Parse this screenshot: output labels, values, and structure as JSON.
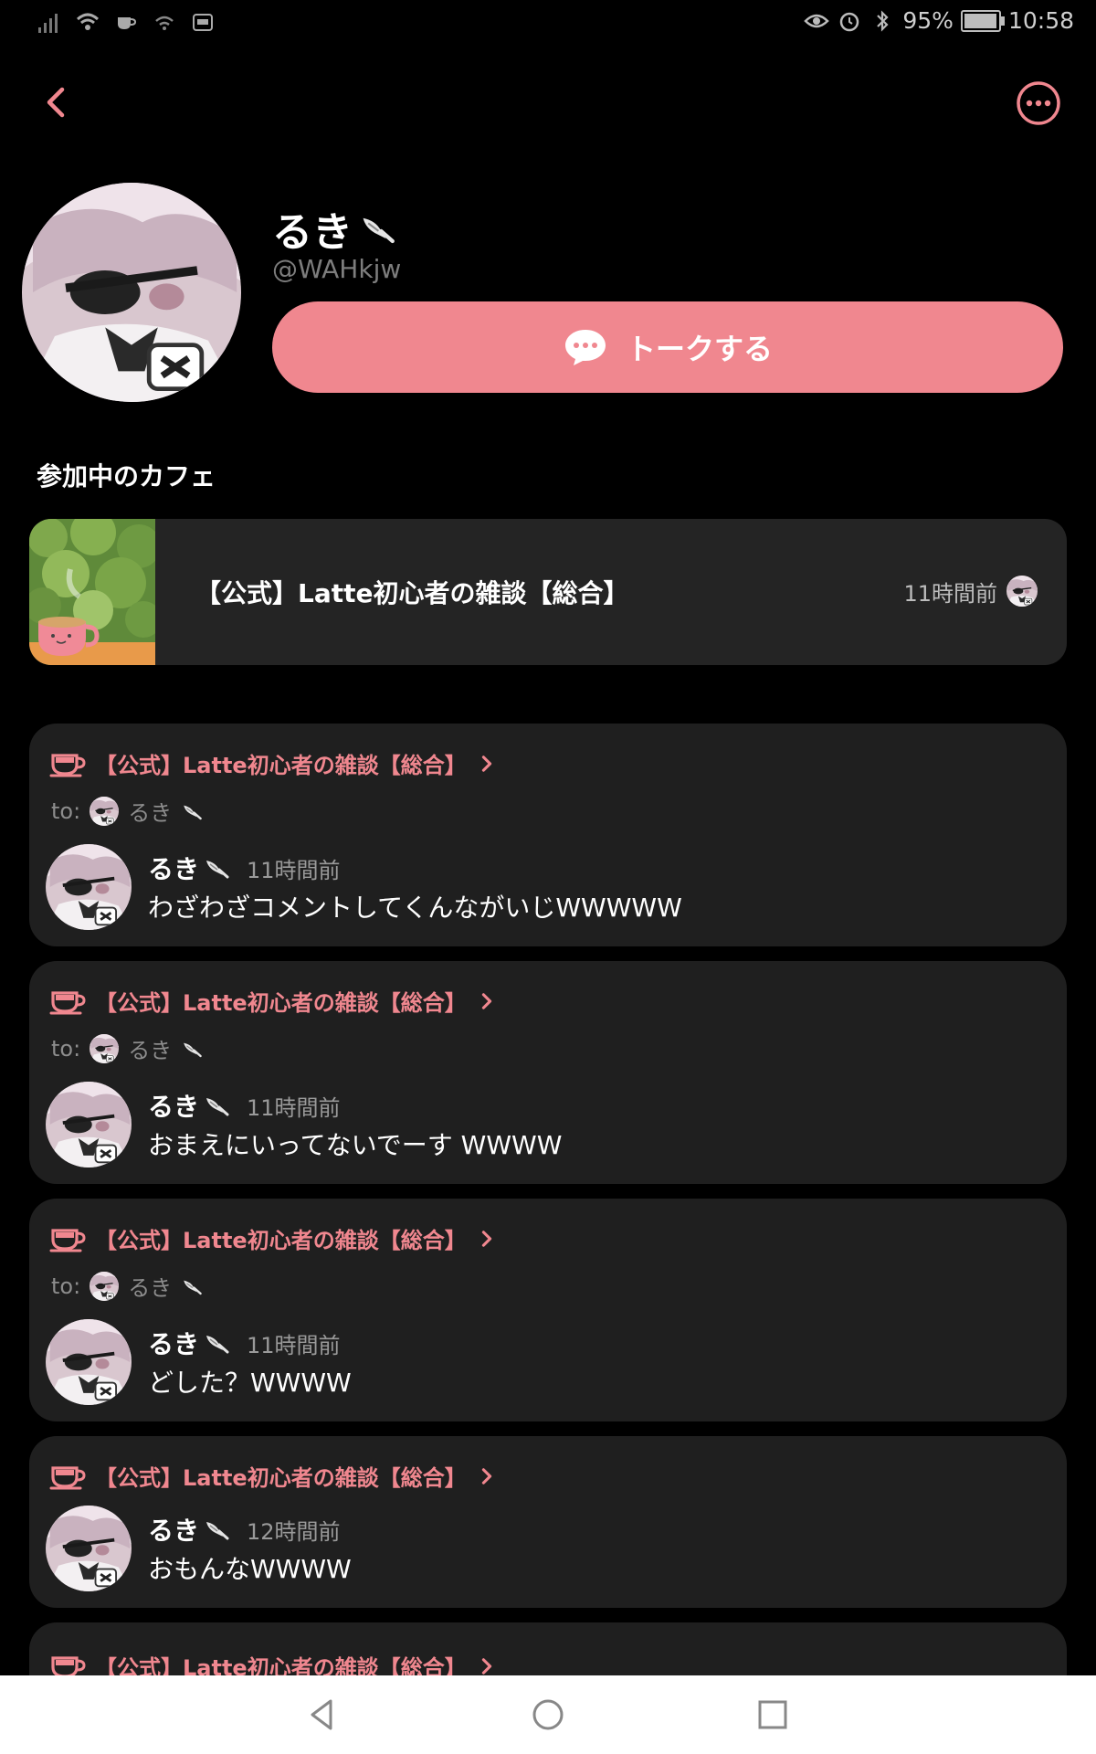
{
  "status_bar": {
    "battery": "95%",
    "time": "10:58",
    "battery_level": 0.95
  },
  "profile": {
    "name": "るき",
    "handle": "@WAHkjw",
    "talk_label": "トークする"
  },
  "section_title": "参加中のカフェ",
  "cafe": {
    "name": "【公式】Latte初心者の雑談【総合】",
    "time": "11時間前"
  },
  "posts": [
    {
      "cafe": "【公式】Latte初心者の雑談【総合】",
      "to_label": "to:",
      "to_name": "るき",
      "author": "るき",
      "time": "11時間前",
      "text": "わざわざコメントしてくんながいじWWWWW"
    },
    {
      "cafe": "【公式】Latte初心者の雑談【総合】",
      "to_label": "to:",
      "to_name": "るき",
      "author": "るき",
      "time": "11時間前",
      "text": "おまえにいってないでーす WWWW"
    },
    {
      "cafe": "【公式】Latte初心者の雑談【総合】",
      "to_label": "to:",
      "to_name": "るき",
      "author": "るき",
      "time": "11時間前",
      "text": "どした？WWWW"
    },
    {
      "cafe": "【公式】Latte初心者の雑談【総合】",
      "author": "るき",
      "time": "12時間前",
      "text": "おもんなWWWW"
    },
    {
      "cafe": "【公式】Latte初心者の雑談【総合】"
    }
  ],
  "icons": {
    "back": "chevron-left-icon",
    "more": "more-horizontal-icon",
    "talk": "chat-bubble-icon",
    "cup": "cup-icon",
    "name_badge": "feather-pen-icon"
  },
  "colors": {
    "accent": "#f0878f",
    "card": "#1f1f1f",
    "background": "#000000"
  }
}
